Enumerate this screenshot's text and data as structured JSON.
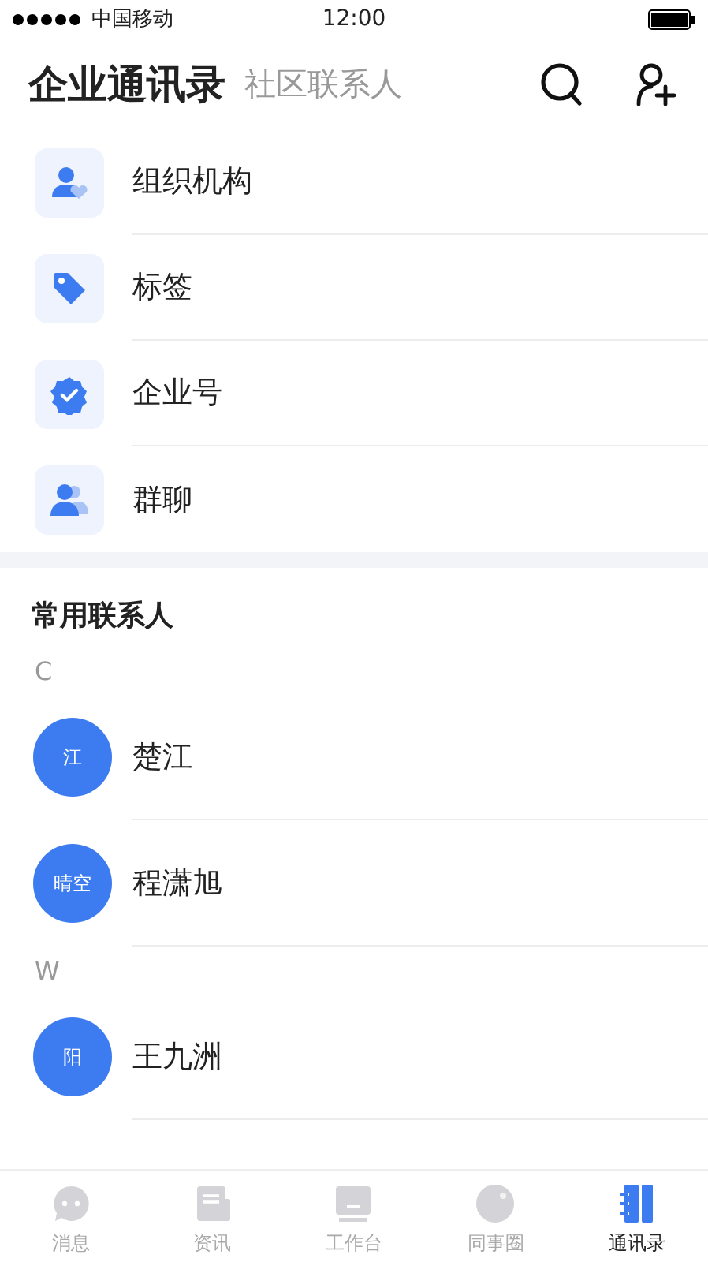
{
  "status_bar": {
    "carrier": "中国移动",
    "time": "12:00"
  },
  "header": {
    "tabs": [
      {
        "label": "企业通讯录",
        "selected": true
      },
      {
        "label": "社区联系人",
        "selected": false
      }
    ]
  },
  "menu": [
    {
      "label": "组织机构"
    },
    {
      "label": "标签"
    },
    {
      "label": "企业号"
    },
    {
      "label": "群聊"
    }
  ],
  "frequent": {
    "title": "常用联系人",
    "groups": [
      {
        "letter": "C",
        "contacts": [
          {
            "avatar": "江",
            "name": "楚江"
          },
          {
            "avatar": "晴空",
            "name": "程潇旭"
          }
        ]
      },
      {
        "letter": "W",
        "contacts": [
          {
            "avatar": "阳",
            "name": "王九洲"
          }
        ]
      }
    ]
  },
  "tab_bar": [
    {
      "label": "消息",
      "selected": false
    },
    {
      "label": "资讯",
      "selected": false
    },
    {
      "label": "工作台",
      "selected": false
    },
    {
      "label": "同事圈",
      "selected": false
    },
    {
      "label": "通讯录",
      "selected": true
    }
  ]
}
